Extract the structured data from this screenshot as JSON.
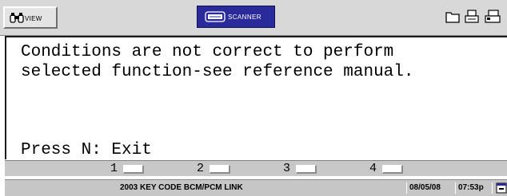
{
  "toolbar": {
    "view_label": "VIEW",
    "scanner_label": "SCANNER",
    "scanner_color": "#2a2a9a"
  },
  "main": {
    "message": "Conditions are not correct to perform\nselected function-see reference manual.",
    "prompt": "Press N: Exit"
  },
  "keys": [
    {
      "label": "1"
    },
    {
      "label": "2"
    },
    {
      "label": "3"
    },
    {
      "label": "4"
    }
  ],
  "status": {
    "title": "2003 KEY CODE  BCM/PCM LINK",
    "date": "08/05/08",
    "time": "07:53p"
  },
  "icons": [
    "binoculars-icon",
    "scanner-icon",
    "folder-icon",
    "printer-icon",
    "printer-icon",
    "calendar-icon"
  ]
}
